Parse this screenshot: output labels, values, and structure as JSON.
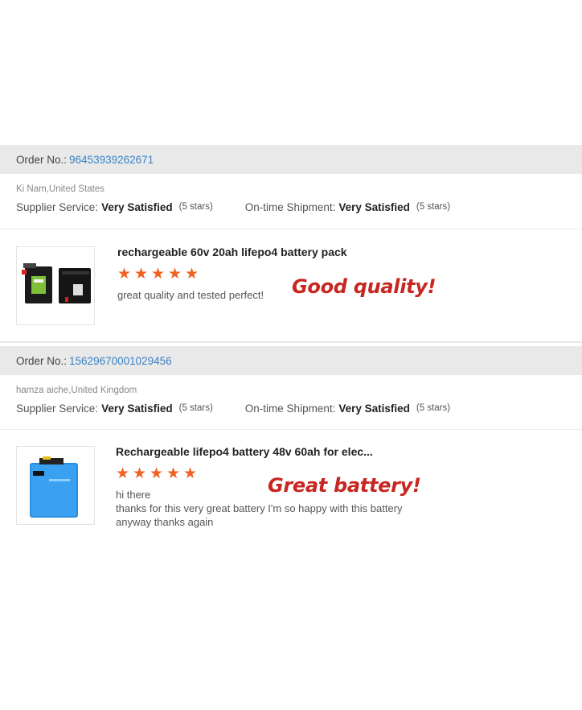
{
  "reviews": [
    {
      "order_label": "Order No.:",
      "order_no": "96453939262671",
      "reviewer": "Ki Nam,United States",
      "supplier_label": "Supplier Service:",
      "supplier_value": "Very Satisfied",
      "supplier_stars": "(5 stars)",
      "shipment_label": "On-time Shipment:",
      "shipment_value": "Very Satisfied",
      "shipment_stars": "(5 stars)",
      "product_title": "rechargeable 60v 20ah lifepo4 battery pack",
      "rating": 5,
      "comment_lines": [
        "great quality and tested perfect!"
      ],
      "overlay_text": "Good quality!",
      "thumb_icon": "battery-pack-image"
    },
    {
      "order_label": "Order No.:",
      "order_no": "15629670001029456",
      "reviewer": "hamza aiche,United Kingdom",
      "supplier_label": "Supplier Service:",
      "supplier_value": "Very Satisfied",
      "supplier_stars": "(5 stars)",
      "shipment_label": "On-time Shipment:",
      "shipment_value": "Very Satisfied",
      "shipment_stars": "(5 stars)",
      "product_title": "Rechargeable lifepo4 battery 48v 60ah for elec...",
      "rating": 5,
      "comment_lines": [
        "hi there",
        "thanks for this very great battery I'm so happy with this battery",
        "anyway thanks again"
      ],
      "overlay_text": "Great battery!",
      "thumb_icon": "blue-battery-image"
    }
  ],
  "colors": {
    "link": "#3a82c4",
    "star": "#f06222",
    "overlay": "#c82620",
    "bar": "#e9e9e9"
  }
}
